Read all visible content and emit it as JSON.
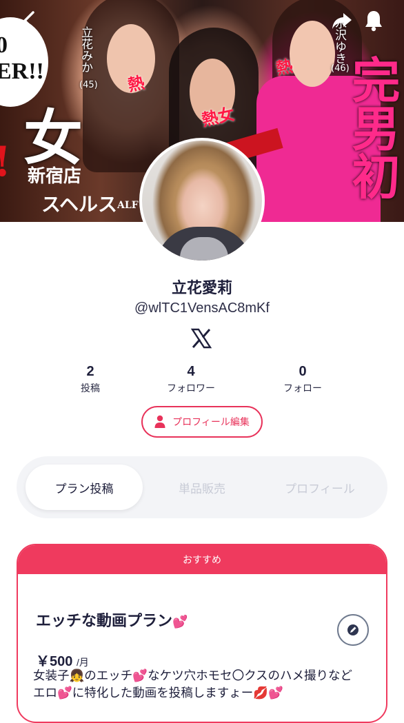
{
  "cover": {
    "badge_text": "0\nER!!",
    "big_char_left": "女",
    "big_chars_right": "完男初",
    "red_left": "!",
    "store_line1": "新宿店",
    "store_line2": "スヘルス",
    "store_small": "ALF HE",
    "performer_left_name": "立花みか",
    "performer_left_age": "(45)",
    "performer_right_name": "水沢ゆき",
    "performer_right_age": "(46)",
    "heat_label": "熱",
    "heat_label_2": "熱女",
    "heat_label_3": "熱"
  },
  "nav": {
    "back_icon": "chevron-left-icon",
    "share_icon": "share-icon",
    "notify_icon": "bell-icon"
  },
  "profile": {
    "name": "立花愛莉",
    "handle": "@wlTC1VensAC8mKf",
    "social_icon": "x-logo-icon",
    "stats": [
      {
        "value": "2",
        "label": "投稿"
      },
      {
        "value": "4",
        "label": "フォロワー"
      },
      {
        "value": "0",
        "label": "フォロー"
      }
    ],
    "edit_label": "プロフィール編集"
  },
  "tabs": [
    {
      "label": "プラン投稿",
      "active": true
    },
    {
      "label": "単品販売",
      "active": false
    },
    {
      "label": "プロフィール",
      "active": false
    }
  ],
  "plan": {
    "badge": "おすすめ",
    "title": "エッチな動画プラン",
    "price": "￥500",
    "period": "/月",
    "description": "女装子👧のエッチ💕なケツ穴ホモセ〇クスのハメ撮りなど\nエロ💕に特化した動画を投稿しますょー💋💕"
  },
  "colors": {
    "accent": "#ef3a5e",
    "text_dark": "#1e1f3b",
    "tab_inactive": "#c8cbd6"
  }
}
